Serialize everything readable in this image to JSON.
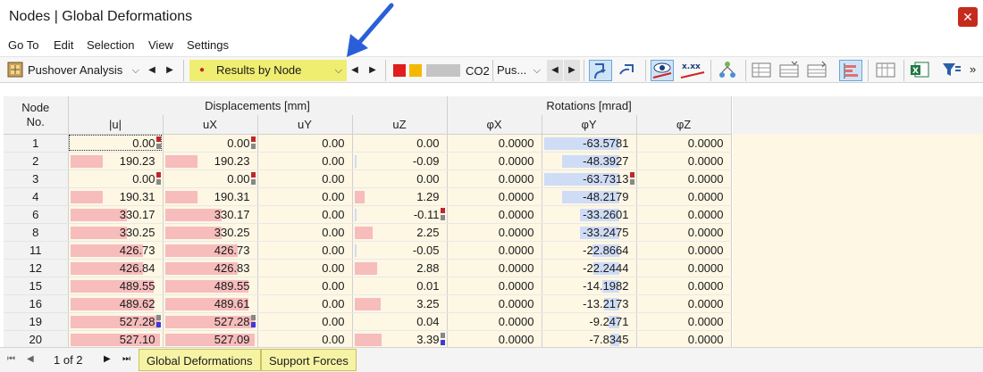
{
  "window": {
    "title": "Nodes | Global Deformations",
    "close_label": "✕"
  },
  "menu": [
    "Go To",
    "Edit",
    "Selection",
    "View",
    "Settings"
  ],
  "toolbar": {
    "analysis": "Pushover Analysis",
    "results_mode": "Results by Node",
    "combo": "CO2",
    "combo_type": "Pus...",
    "more": "»"
  },
  "grid": {
    "header": {
      "node_line1": "Node",
      "node_line2": "No.",
      "group_disp": "Displacements [mm]",
      "group_rot": "Rotations [mrad]",
      "cols": [
        "|u|",
        "uX",
        "uY",
        "uZ",
        "φX",
        "φY",
        "φZ"
      ]
    },
    "rows": [
      {
        "node": "1",
        "u": "0.00",
        "ux": "0.00",
        "uy": "0.00",
        "uz": "0.00",
        "px": "0.0000",
        "py": "-63.5781",
        "pz": "0.0000"
      },
      {
        "node": "2",
        "u": "190.23",
        "ux": "190.23",
        "uy": "0.00",
        "uz": "-0.09",
        "px": "0.0000",
        "py": "-48.3927",
        "pz": "0.0000"
      },
      {
        "node": "3",
        "u": "0.00",
        "ux": "0.00",
        "uy": "0.00",
        "uz": "0.00",
        "px": "0.0000",
        "py": "-63.7313",
        "pz": "0.0000"
      },
      {
        "node": "4",
        "u": "190.31",
        "ux": "190.31",
        "uy": "0.00",
        "uz": "1.29",
        "px": "0.0000",
        "py": "-48.2179",
        "pz": "0.0000"
      },
      {
        "node": "6",
        "u": "330.17",
        "ux": "330.17",
        "uy": "0.00",
        "uz": "-0.11",
        "px": "0.0000",
        "py": "-33.2601",
        "pz": "0.0000"
      },
      {
        "node": "8",
        "u": "330.25",
        "ux": "330.25",
        "uy": "0.00",
        "uz": "2.25",
        "px": "0.0000",
        "py": "-33.2475",
        "pz": "0.0000"
      },
      {
        "node": "11",
        "u": "426.73",
        "ux": "426.73",
        "uy": "0.00",
        "uz": "-0.05",
        "px": "0.0000",
        "py": "-22.8664",
        "pz": "0.0000"
      },
      {
        "node": "12",
        "u": "426.84",
        "ux": "426.83",
        "uy": "0.00",
        "uz": "2.88",
        "px": "0.0000",
        "py": "-22.2444",
        "pz": "0.0000"
      },
      {
        "node": "15",
        "u": "489.55",
        "ux": "489.55",
        "uy": "0.00",
        "uz": "0.01",
        "px": "0.0000",
        "py": "-14.1982",
        "pz": "0.0000"
      },
      {
        "node": "16",
        "u": "489.62",
        "ux": "489.61",
        "uy": "0.00",
        "uz": "3.25",
        "px": "0.0000",
        "py": "-13.2173",
        "pz": "0.0000"
      },
      {
        "node": "19",
        "u": "527.28",
        "ux": "527.28",
        "uy": "0.00",
        "uz": "0.04",
        "px": "0.0000",
        "py": "-9.2471",
        "pz": "0.0000"
      },
      {
        "node": "20",
        "u": "527.10",
        "ux": "527.09",
        "uy": "0.00",
        "uz": "3.39",
        "px": "0.0000",
        "py": "-7.8345",
        "pz": "0.0000"
      }
    ]
  },
  "status": {
    "page": "1 of 2",
    "tabs": [
      "Global Deformations",
      "Support Forces"
    ]
  },
  "colors": {
    "bar_red": "#f7bcbc",
    "bar_blue": "#cfdcf6",
    "tab_yellow": "#f7f3a5",
    "callout_arrow": "#2b5fd9"
  }
}
